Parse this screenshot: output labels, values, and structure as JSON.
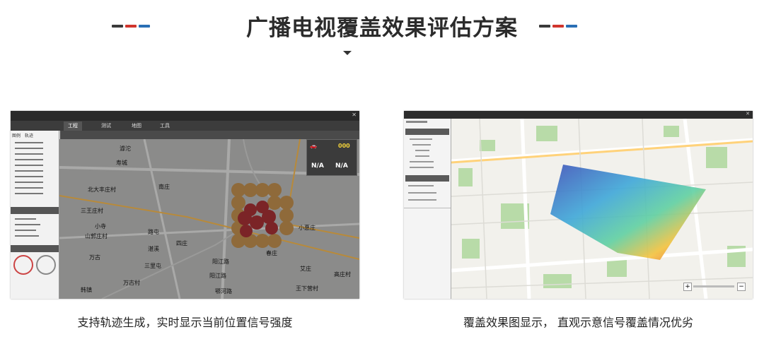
{
  "title": "广播电视覆盖效果评估方案",
  "colors": {
    "deco_dark": "#3a3a3a",
    "deco_red": "#d0352d",
    "deco_blue": "#2a6fb5"
  },
  "left_panel": {
    "caption": "支持轨迹生成，实时显示当前位置信号强度",
    "tabs": [
      "工程",
      "测试",
      "地图",
      "工具"
    ],
    "side_tabs": [
      "图例",
      "轨迹"
    ],
    "map_labels": [
      "滹沱",
      "寿城",
      "北大丰庄村",
      "三王庄村",
      "小寺",
      "山郭庄村",
      "万古",
      "韩镇",
      "三里屯",
      "万古村",
      "南庄",
      "路屯",
      "湛溪",
      "四庄",
      "阳江路",
      "阳江路",
      "鄂河路",
      "高庄村",
      "王下营村",
      "艾庄",
      "春庄",
      "小惠庄"
    ],
    "status_values": [
      "N/A",
      "N/A"
    ],
    "counter": "000"
  },
  "right_panel": {
    "caption": "覆盖效果图显示， 直观示意信号覆盖情况优劣",
    "zoom_in": "+",
    "zoom_out": "−"
  }
}
